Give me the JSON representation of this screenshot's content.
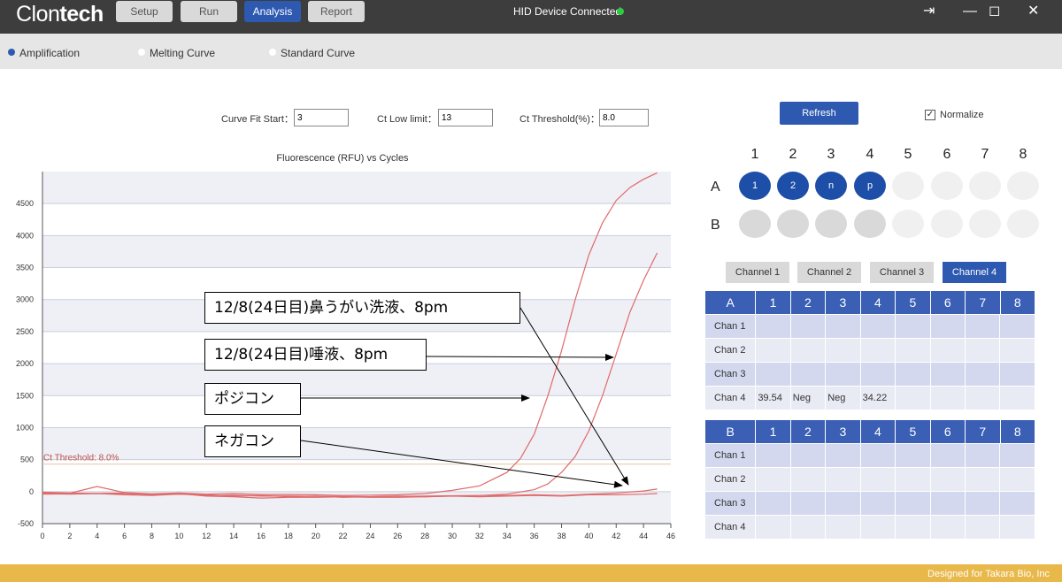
{
  "app": {
    "logo_light": "Clon",
    "logo_bold": "tech",
    "tabs": [
      {
        "label": "Setup",
        "active": false
      },
      {
        "label": "Run",
        "active": false
      },
      {
        "label": "Analysis",
        "active": true
      },
      {
        "label": "Report",
        "active": false
      }
    ],
    "device_status": "HID Device Connected",
    "device_status_color": "#2ecc40"
  },
  "window_controls": {
    "exit": "⇥",
    "minimize": "—",
    "maximize": "◻",
    "close": "✕"
  },
  "modes": [
    {
      "label": "Amplification",
      "selected": true
    },
    {
      "label": "Melting Curve",
      "selected": false
    },
    {
      "label": "Standard Curve",
      "selected": false
    }
  ],
  "params": {
    "curve_fit_label": "Curve Fit Start：",
    "curve_fit_value": "3",
    "ct_low_label": "Ct Low limit：",
    "ct_low_value": "13",
    "ct_threshold_label": "Ct Threshold(%)：",
    "ct_threshold_value": "8.0"
  },
  "chart_data": {
    "type": "line",
    "title": "Fluorescence (RFU) vs Cycles",
    "xlabel": "",
    "ylabel": "",
    "xlim": [
      0,
      46
    ],
    "ylim": [
      -500,
      5000
    ],
    "x_ticks": [
      0,
      2,
      4,
      6,
      8,
      10,
      12,
      14,
      16,
      18,
      20,
      22,
      24,
      26,
      28,
      30,
      32,
      34,
      36,
      38,
      40,
      42,
      44,
      46
    ],
    "y_ticks": [
      -500,
      0,
      500,
      1000,
      1500,
      2000,
      2500,
      3000,
      3500,
      4000,
      4500
    ],
    "threshold": {
      "label": "Ct Threshold: 8.0%",
      "value": 430
    },
    "grid": true,
    "legend": "none",
    "series": [
      {
        "color": "#e06a6a",
        "x": [
          0,
          2,
          4,
          6,
          8,
          10,
          12,
          14,
          16,
          18,
          20,
          22,
          24,
          26,
          28,
          30,
          32,
          34,
          35,
          36,
          37,
          38,
          39,
          40,
          41,
          42,
          43,
          44,
          45
        ],
        "y": [
          -20,
          -25,
          80,
          -15,
          -35,
          -20,
          -40,
          -30,
          -45,
          -45,
          -50,
          -60,
          -55,
          -50,
          -30,
          20,
          90,
          300,
          520,
          900,
          1500,
          2200,
          3000,
          3700,
          4200,
          4550,
          4750,
          4880,
          4980
        ]
      },
      {
        "color": "#e06a6a",
        "x": [
          0,
          2,
          4,
          6,
          8,
          10,
          12,
          14,
          16,
          18,
          20,
          22,
          24,
          26,
          28,
          30,
          32,
          34,
          36,
          37,
          38,
          39,
          40,
          41,
          42,
          43,
          44,
          45
        ],
        "y": [
          -40,
          -35,
          -30,
          -30,
          -45,
          -40,
          -60,
          -55,
          -70,
          -70,
          -75,
          -75,
          -80,
          -75,
          -70,
          -65,
          -60,
          -40,
          30,
          120,
          300,
          550,
          950,
          1500,
          2150,
          2800,
          3300,
          3730
        ]
      },
      {
        "color": "#e06a6a",
        "x": [
          0,
          2,
          4,
          6,
          8,
          10,
          12,
          14,
          16,
          18,
          20,
          22,
          24,
          26,
          28,
          30,
          32,
          34,
          36,
          38,
          40,
          42,
          44,
          45
        ],
        "y": [
          -10,
          -20,
          -30,
          -20,
          -50,
          -30,
          -70,
          -80,
          -100,
          -90,
          -90,
          -80,
          -90,
          -90,
          -80,
          -70,
          -60,
          -60,
          -50,
          -60,
          -40,
          -20,
          10,
          40
        ]
      },
      {
        "color": "#e06a6a",
        "x": [
          0,
          2,
          4,
          6,
          8,
          10,
          12,
          14,
          16,
          18,
          20,
          22,
          24,
          26,
          28,
          30,
          32,
          34,
          36,
          38,
          40,
          42,
          44,
          45
        ],
        "y": [
          -30,
          -40,
          -30,
          -50,
          -60,
          -40,
          -50,
          -70,
          -60,
          -80,
          -70,
          -90,
          -80,
          -70,
          -80,
          -70,
          -80,
          -70,
          -60,
          -70,
          -50,
          -50,
          -40,
          -30
        ]
      }
    ]
  },
  "annotations": [
    {
      "text": "12/8(24日目)鼻うがい洗液、8pm"
    },
    {
      "text": "12/8(24日目)唾液、8pm"
    },
    {
      "text": "ポジコン"
    },
    {
      "text": "ネガコン"
    }
  ],
  "right_panel": {
    "refresh_label": "Refresh",
    "normalize_label": "Normalize",
    "normalize_checked": true,
    "columns": [
      "1",
      "2",
      "3",
      "4",
      "5",
      "6",
      "7",
      "8"
    ],
    "rows": [
      "A",
      "B"
    ],
    "wells_A": [
      "1",
      "2",
      "n",
      "p",
      "",
      "",
      "",
      ""
    ],
    "wells_B": [
      "",
      "",
      "",
      "",
      "",
      "",
      "",
      ""
    ],
    "channel_tabs": [
      {
        "label": "Channel 1",
        "active": false
      },
      {
        "label": "Channel 2",
        "active": false
      },
      {
        "label": "Channel 3",
        "active": false
      },
      {
        "label": "Channel 4",
        "active": true
      }
    ],
    "table_A": {
      "header": [
        "A",
        "1",
        "2",
        "3",
        "4",
        "5",
        "6",
        "7",
        "8"
      ],
      "rows": [
        [
          "Chan 1",
          "",
          "",
          "",
          "",
          "",
          "",
          "",
          ""
        ],
        [
          "Chan 2",
          "",
          "",
          "",
          "",
          "",
          "",
          "",
          ""
        ],
        [
          "Chan 3",
          "",
          "",
          "",
          "",
          "",
          "",
          "",
          ""
        ],
        [
          "Chan 4",
          "39.54",
          "Neg",
          "Neg",
          "34.22",
          "",
          "",
          "",
          ""
        ]
      ]
    },
    "table_B": {
      "header": [
        "B",
        "1",
        "2",
        "3",
        "4",
        "5",
        "6",
        "7",
        "8"
      ],
      "rows": [
        [
          "Chan 1",
          "",
          "",
          "",
          "",
          "",
          "",
          "",
          ""
        ],
        [
          "Chan 2",
          "",
          "",
          "",
          "",
          "",
          "",
          "",
          ""
        ],
        [
          "Chan 3",
          "",
          "",
          "",
          "",
          "",
          "",
          "",
          ""
        ],
        [
          "Chan 4",
          "",
          "",
          "",
          "",
          "",
          "",
          "",
          ""
        ]
      ]
    }
  },
  "footer": {
    "text": "Designed for Takara Bio, Inc"
  }
}
